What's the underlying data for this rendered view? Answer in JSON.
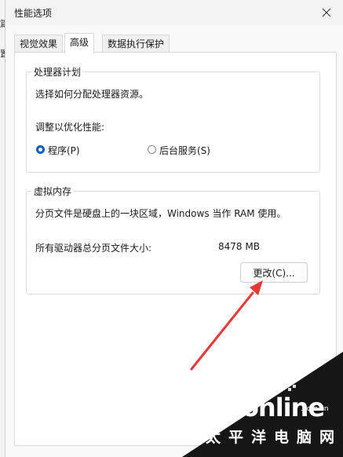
{
  "background_fragments": [
    "篇",
    "置"
  ],
  "window": {
    "title": "性能选项"
  },
  "tabs": [
    {
      "label": "视觉效果",
      "active": false
    },
    {
      "label": "高级",
      "active": true
    },
    {
      "label": "数据执行保护",
      "active": false
    }
  ],
  "processor_group": {
    "title": "处理器计划",
    "description": "选择如何分配处理器资源。",
    "adjust_label": "调整以优化性能:",
    "options": [
      {
        "label": "程序(P)",
        "selected": true
      },
      {
        "label": "后台服务(S)",
        "selected": false
      }
    ]
  },
  "virtual_memory_group": {
    "title": "虚拟内存",
    "description": "分页文件是硬盘上的一块区域，Windows 当作 RAM 使用。",
    "total_label": "所有驱动器总分页文件大小:",
    "total_value": "8478 MB",
    "change_button": "更改(C)..."
  },
  "annotation": {
    "arrow_color": "#e53935"
  },
  "watermark": {
    "logo": "PConline",
    "domain": ".com.cn",
    "cn": "太平洋电脑网"
  }
}
